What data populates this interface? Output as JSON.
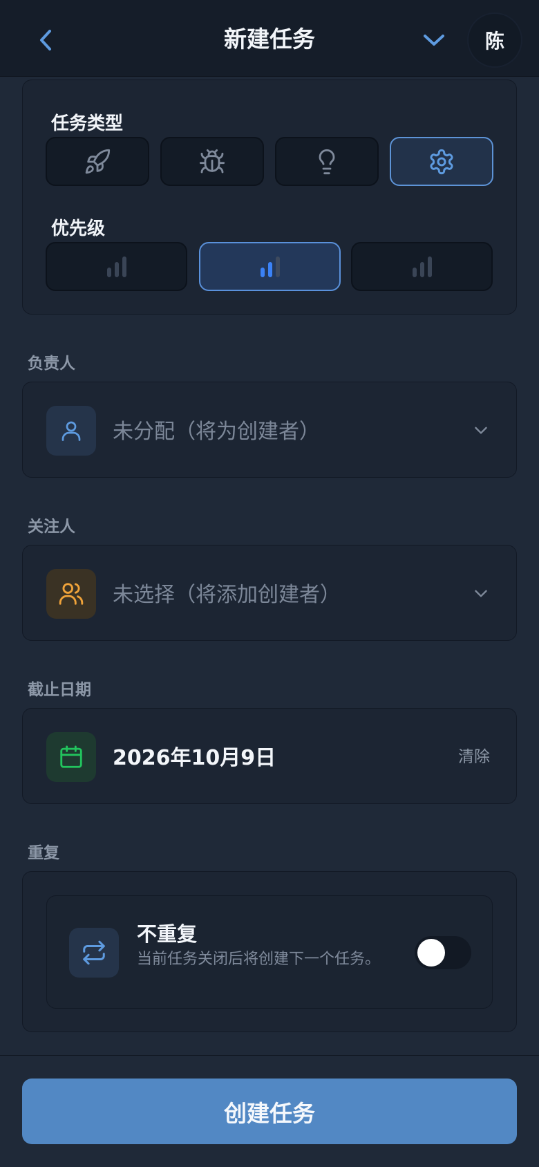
{
  "header": {
    "title": "新建任务",
    "avatar_text": "陈",
    "back_icon": "chevron-left-icon",
    "collapse_icon": "chevron-down-icon"
  },
  "task_type": {
    "label": "任务类型",
    "options": [
      {
        "icon": "rocket-icon",
        "selected": false
      },
      {
        "icon": "bug-icon",
        "selected": false
      },
      {
        "icon": "lightbulb-icon",
        "selected": false
      },
      {
        "icon": "gear-icon",
        "selected": true
      }
    ]
  },
  "priority": {
    "label": "优先级",
    "options": [
      {
        "level": "low",
        "active_bars": 1,
        "selected": false
      },
      {
        "level": "medium",
        "active_bars": 2,
        "selected": true
      },
      {
        "level": "high",
        "active_bars": 3,
        "selected": false
      }
    ]
  },
  "assignee": {
    "label": "负责人",
    "value": "未分配（将为创建者）",
    "icon": "user-icon"
  },
  "followers": {
    "label": "关注人",
    "value": "未选择（将添加创建者）",
    "icon": "users-icon"
  },
  "due_date": {
    "label": "截止日期",
    "value": "2026年10月9日",
    "clear_label": "清除",
    "icon": "calendar-icon"
  },
  "repeat": {
    "label": "重复",
    "title": "不重复",
    "description": "当前任务关闭后将创建下一个任务。",
    "icon": "repeat-icon",
    "enabled": false
  },
  "submit": {
    "label": "创建任务"
  },
  "colors": {
    "background": "#1f2938",
    "accent": "#5288c4",
    "selected_border": "#5d93d6",
    "priority_active": "#3b82f6",
    "followers_icon": "#f0a33a",
    "calendar_icon": "#22c55e"
  }
}
